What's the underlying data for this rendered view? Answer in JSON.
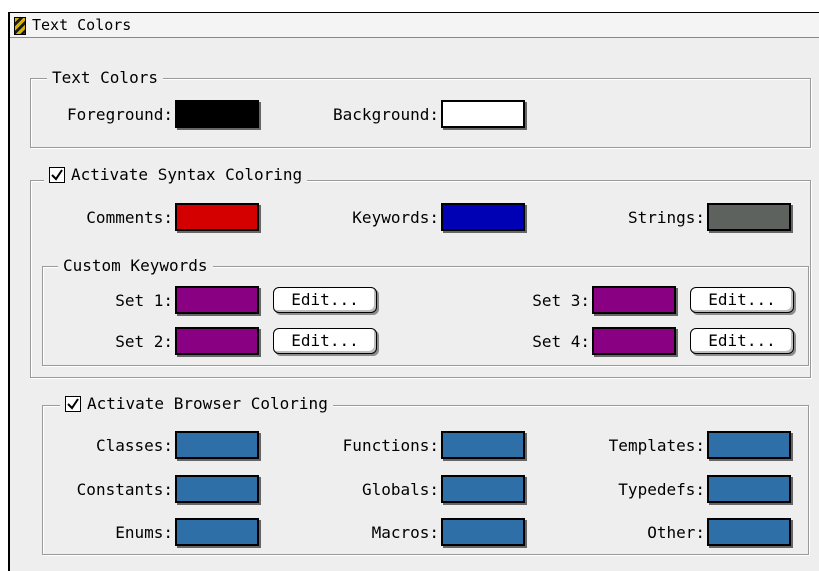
{
  "window": {
    "title": "Text Colors"
  },
  "text_colors": {
    "legend": "Text Colors",
    "foreground": {
      "label": "Foreground:",
      "color": "#000000"
    },
    "background": {
      "label": "Background:",
      "color": "#ffffff"
    }
  },
  "syntax": {
    "legend": "Activate Syntax Coloring",
    "checked": true,
    "comments": {
      "label": "Comments:",
      "color": "#d40000"
    },
    "keywords": {
      "label": "Keywords:",
      "color": "#0000b4"
    },
    "strings": {
      "label": "Strings:",
      "color": "#5e625e"
    },
    "custom": {
      "legend": "Custom Keywords",
      "edit_label": "Edit...",
      "set1": {
        "label": "Set 1:",
        "color": "#8a0082"
      },
      "set2": {
        "label": "Set 2:",
        "color": "#8a0082"
      },
      "set3": {
        "label": "Set 3:",
        "color": "#8a0082"
      },
      "set4": {
        "label": "Set 4:",
        "color": "#8a0082"
      }
    }
  },
  "browser": {
    "legend": "Activate Browser Coloring",
    "checked": true,
    "color": "#2f6fa8",
    "classes": {
      "label": "Classes:"
    },
    "constants": {
      "label": "Constants:"
    },
    "enums": {
      "label": "Enums:"
    },
    "functions": {
      "label": "Functions:"
    },
    "globals": {
      "label": "Globals:"
    },
    "macros": {
      "label": "Macros:"
    },
    "templates": {
      "label": "Templates:"
    },
    "typedefs": {
      "label": "Typedefs:"
    },
    "other": {
      "label": "Other:"
    }
  }
}
